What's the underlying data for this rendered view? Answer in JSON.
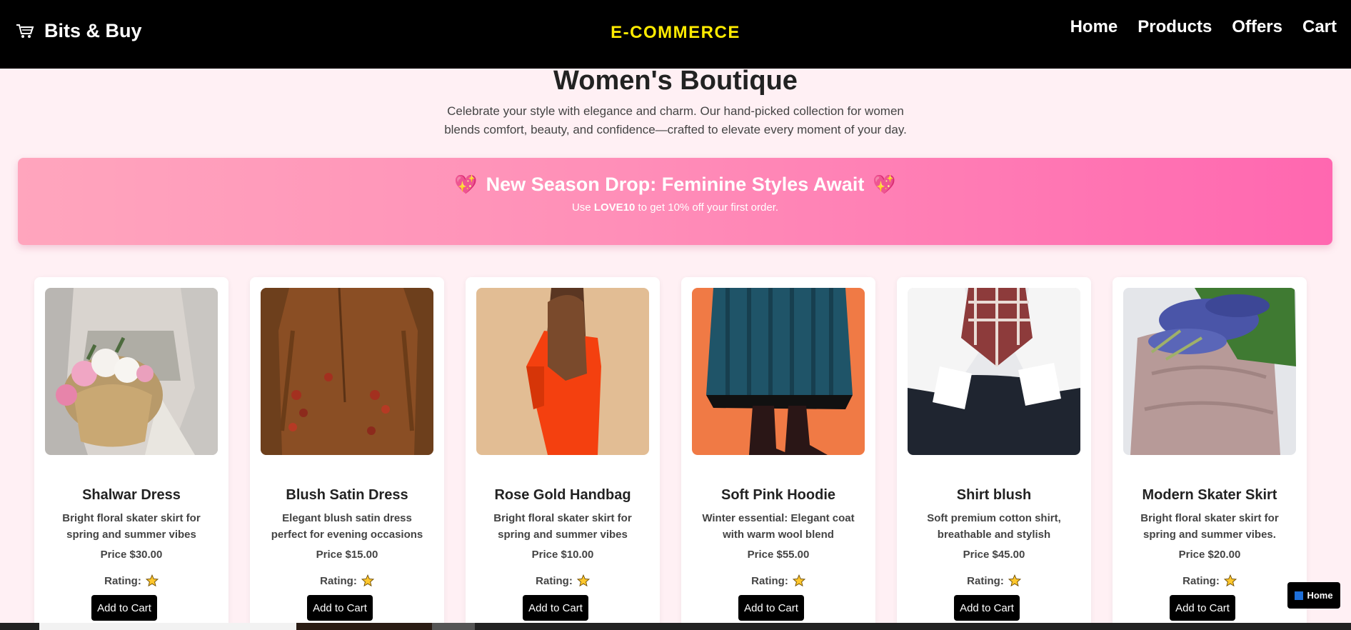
{
  "navbar": {
    "brand": "Bits & Buy",
    "center_title": "E-COMMERCE",
    "links": [
      "Home",
      "Products",
      "Offers",
      "Cart"
    ]
  },
  "hero": {
    "title": "Women's Boutique",
    "description": "Celebrate your style with elegance and charm. Our hand-picked collection for women blends comfort, beauty, and confidence—crafted to elevate every moment of your day."
  },
  "banner": {
    "title": "New Season Drop: Feminine Styles Await",
    "heart_icon": "💖",
    "sub_prefix": "Use",
    "code": "LOVE10",
    "sub_suffix": "to get 10% off your first order."
  },
  "products": [
    {
      "name": "Shalwar Dress",
      "desc": "Bright floral skater skirt for spring and summer vibes",
      "price": "Price $30.00",
      "rating_label": "Rating:",
      "button": "Add to Cart",
      "image": "woman-with-flower-basket"
    },
    {
      "name": "Blush Satin Dress",
      "desc": "Elegant blush satin dress perfect for evening occasions",
      "price": "Price $15.00",
      "rating_label": "Rating:",
      "button": "Add to Cart",
      "image": "brown-suit-with-berries"
    },
    {
      "name": "Rose Gold Handbag",
      "desc": "Bright floral skater skirt for spring and summer vibes",
      "price": "Price $10.00",
      "rating_label": "Rating:",
      "button": "Add to Cart",
      "image": "orange-sweater-long-hair"
    },
    {
      "name": "Soft Pink Hoodie",
      "desc": "Winter essential: Elegant coat with warm wool blend",
      "price": "Price $55.00",
      "rating_label": "Rating:",
      "button": "Add to Cart",
      "image": "teal-pleated-skirt-boots"
    },
    {
      "name": "Shirt blush",
      "desc": "Soft premium cotton shirt, breathable and stylish",
      "price": "Price $45.00",
      "rating_label": "Rating:",
      "button": "Add to Cart",
      "image": "white-shirt-plaid-scarf"
    },
    {
      "name": "Modern Skater Skirt",
      "desc": "Bright floral skater skirt for spring and summer vibes.",
      "price": "Price $20.00",
      "rating_label": "Rating:",
      "button": "Add to Cart",
      "image": "lavender-bouquet-pink-dress"
    }
  ],
  "rating": {
    "stars": 1,
    "of": 5
  },
  "float_button": {
    "label": "Home"
  },
  "colors": {
    "nav_bg": "#000000",
    "center_title": "#ffeb00",
    "page_bg": "#fff0f4",
    "banner_start": "#ffa5bd",
    "banner_end": "#ff67b0",
    "button_bg": "#000000"
  }
}
